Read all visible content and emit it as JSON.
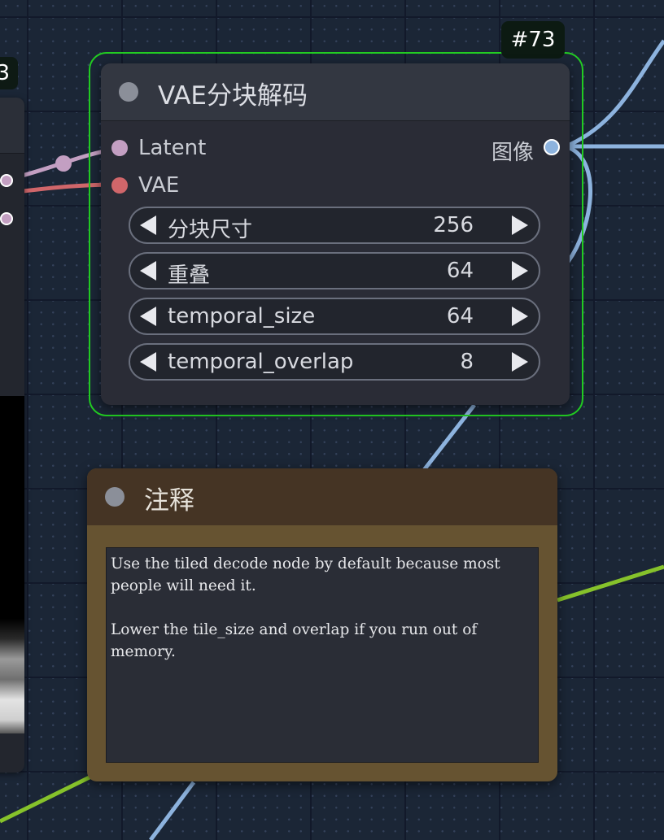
{
  "vae_node": {
    "badge": "#73",
    "title": "VAE分块解码",
    "inputs": [
      {
        "label": "Latent",
        "color": "#c39fc2"
      },
      {
        "label": "VAE",
        "color": "#d0666a"
      }
    ],
    "output": {
      "label": "图像",
      "color": "#8db3de"
    },
    "widgets": [
      {
        "label": "分块尺寸",
        "value": "256"
      },
      {
        "label": "重叠",
        "value": "64"
      },
      {
        "label": "temporal_size",
        "value": "64"
      },
      {
        "label": "temporal_overlap",
        "value": "8"
      }
    ]
  },
  "left_node": {
    "badge": "3"
  },
  "note_node": {
    "title": "注释",
    "text": "Use the tiled decode node by default because most people will need it.\n\nLower the tile_size and overlap if you run out of memory."
  },
  "colors": {
    "selection_outline": "#22cc22",
    "latent_link": "#c39fc2",
    "vae_link": "#d0666a",
    "image_link": "#8db3de",
    "green_link": "#86c22b"
  }
}
